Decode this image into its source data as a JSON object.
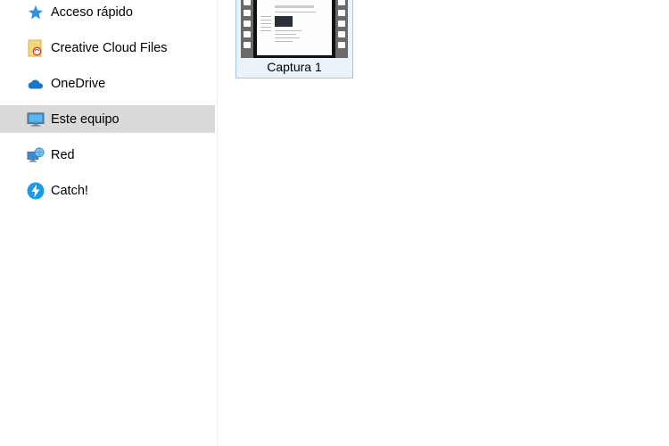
{
  "sidebar": {
    "items": [
      {
        "label": "Acceso rápido",
        "icon": "star-icon",
        "selected": false
      },
      {
        "label": "Creative Cloud Files",
        "icon": "creative-cloud-folder-icon",
        "selected": false
      },
      {
        "label": "OneDrive",
        "icon": "onedrive-cloud-icon",
        "selected": false
      },
      {
        "label": "Este equipo",
        "icon": "computer-monitor-icon",
        "selected": true
      },
      {
        "label": "Red",
        "icon": "network-icon",
        "selected": false
      },
      {
        "label": "Catch!",
        "icon": "catch-bolt-icon",
        "selected": false
      }
    ]
  },
  "files": [
    {
      "name": "Captura 1",
      "icon": "video-file-thumbnail",
      "selected": true
    }
  ],
  "colors": {
    "selection_bg": "#d9d9d9",
    "tile_bg": "#eaf3fc",
    "tile_border": "#99c9ef",
    "accent_blue": "#1a8ad4"
  }
}
